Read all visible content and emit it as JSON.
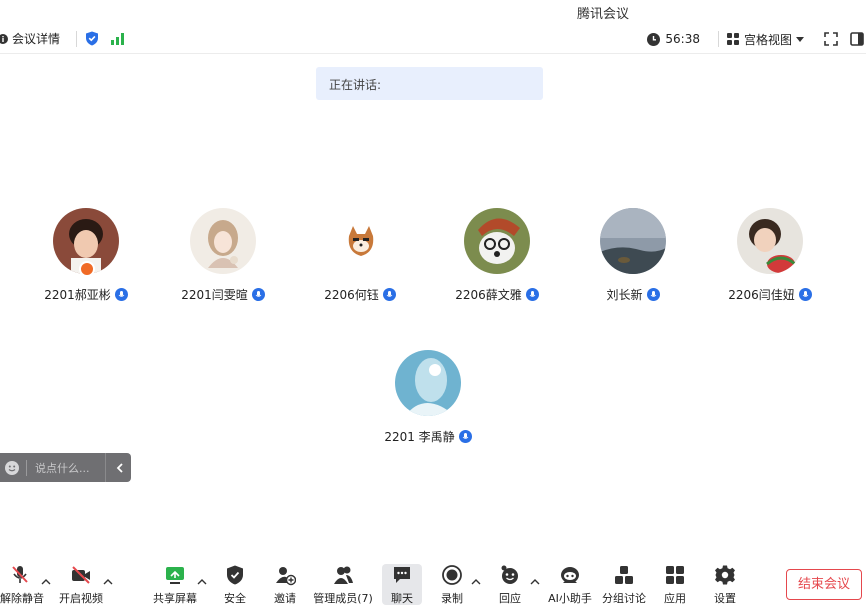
{
  "window": {
    "title": "腾讯会议"
  },
  "topbar": {
    "meeting_info": "会议详情",
    "timer": "56:38",
    "view_mode": "宫格视图"
  },
  "speaking": {
    "label": "正在讲话:"
  },
  "participants": [
    {
      "name": "2201郝亚彬"
    },
    {
      "name": "2201闫雯暄"
    },
    {
      "name": "2206何钰"
    },
    {
      "name": "2206薛文雅"
    },
    {
      "name": "刘长新"
    },
    {
      "name": "2206闫佳妞"
    },
    {
      "name": "2201 李禹静"
    }
  ],
  "chat": {
    "placeholder": "说点什么..."
  },
  "toolbar": {
    "unmute": "解除静音",
    "start_video": "开启视频",
    "share_screen": "共享屏幕",
    "security": "安全",
    "invite": "邀请",
    "manage_members": "管理成员(7)",
    "chat": "聊天",
    "record": "录制",
    "reactions": "回应",
    "ai_assistant": "AI小助手",
    "breakout": "分组讨论",
    "apps": "应用",
    "settings": "设置",
    "end_meeting": "结束会议"
  },
  "colors": {
    "accent_blue": "#2a6fe6",
    "signal_green": "#2bb24c",
    "end_red": "#e5484d",
    "speaking_bg": "#e8effd",
    "host_badge": "#f06a25"
  },
  "icons": [
    "info-icon",
    "shield-icon",
    "signal-icon",
    "clock-icon",
    "grid-view-icon",
    "fullscreen-icon",
    "side-panel-icon",
    "mic-icon",
    "emoji-icon",
    "chevron-left-icon",
    "mic-off-icon",
    "video-off-icon",
    "share-screen-icon",
    "invite-icon",
    "members-icon",
    "chat-icon",
    "record-icon",
    "reaction-icon",
    "ai-assistant-icon",
    "breakout-icon",
    "apps-icon",
    "settings-icon"
  ]
}
